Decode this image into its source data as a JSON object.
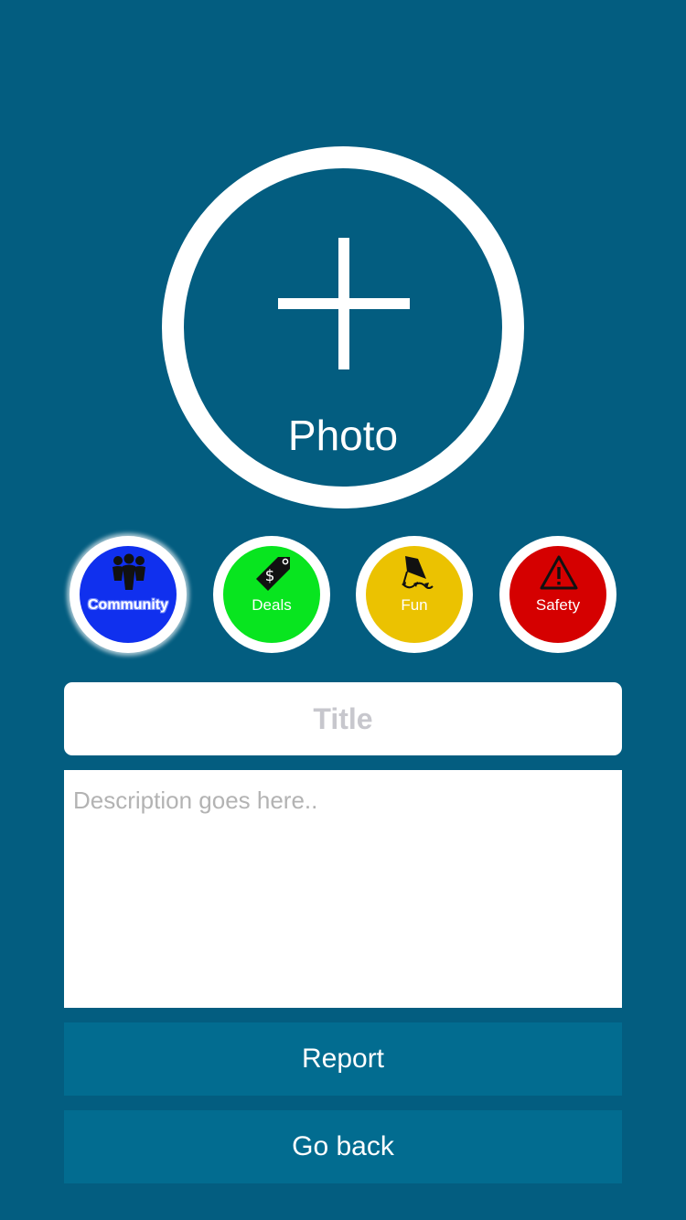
{
  "photo": {
    "label": "Photo",
    "icon": "plus-icon"
  },
  "categories": [
    {
      "label": "Community",
      "icon": "people-icon",
      "color": "#1030ee"
    },
    {
      "label": "Deals",
      "icon": "price-tag-icon",
      "color": "#08e51f"
    },
    {
      "label": "Fun",
      "icon": "kite-icon",
      "color": "#ebc201"
    },
    {
      "label": "Safety",
      "icon": "warning-icon",
      "color": "#d50000"
    }
  ],
  "title_field": {
    "value": "",
    "placeholder": "Title"
  },
  "description_field": {
    "value": "",
    "placeholder": "Description goes here.."
  },
  "actions": {
    "report_label": "Report",
    "back_label": "Go back"
  },
  "colors": {
    "background": "#035d80",
    "button": "#026c90"
  }
}
